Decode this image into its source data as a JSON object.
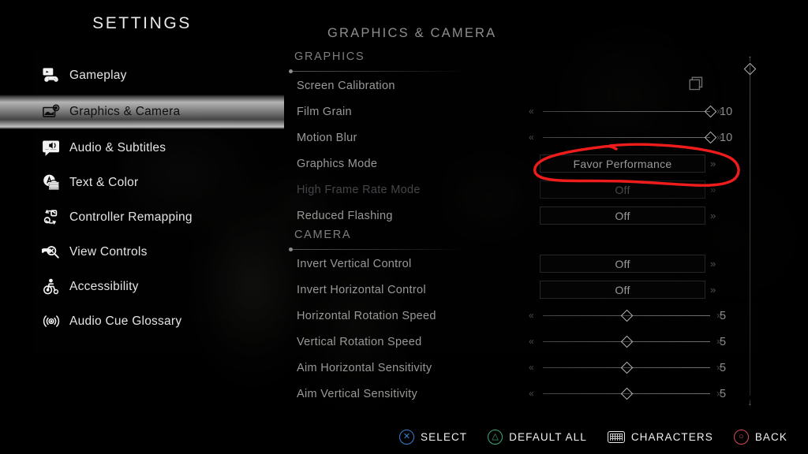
{
  "app": {
    "title": "SETTINGS"
  },
  "sidebar": {
    "items": [
      {
        "label": "Gameplay",
        "icon": "gameplay-icon",
        "selected": false
      },
      {
        "label": "Graphics & Camera",
        "icon": "graphics-camera-icon",
        "selected": true
      },
      {
        "label": "Audio & Subtitles",
        "icon": "audio-subtitles-icon",
        "selected": false
      },
      {
        "label": "Text & Color",
        "icon": "text-color-icon",
        "selected": false
      },
      {
        "label": "Controller Remapping",
        "icon": "controller-remapping-icon",
        "selected": false
      },
      {
        "label": "View Controls",
        "icon": "view-controls-icon",
        "selected": false
      },
      {
        "label": "Accessibility",
        "icon": "accessibility-icon",
        "selected": false
      },
      {
        "label": "Audio Cue Glossary",
        "icon": "audio-cue-glossary-icon",
        "selected": false
      }
    ]
  },
  "main": {
    "page_title": "GRAPHICS & CAMERA",
    "sections": [
      {
        "heading": "GRAPHICS",
        "rows": [
          {
            "label": "Screen Calibration",
            "type": "submenu",
            "icon": "stacked-squares-icon"
          },
          {
            "label": "Film Grain",
            "type": "slider",
            "value": "10",
            "percent": 100
          },
          {
            "label": "Motion Blur",
            "type": "slider",
            "value": "10",
            "percent": 100
          },
          {
            "label": "Graphics Mode",
            "type": "select",
            "value": "Favor Performance",
            "highlighted": true
          },
          {
            "label": "High Frame Rate Mode",
            "type": "select",
            "value": "Off",
            "disabled": true
          },
          {
            "label": "Reduced Flashing",
            "type": "select",
            "value": "Off"
          }
        ]
      },
      {
        "heading": "CAMERA",
        "rows": [
          {
            "label": "Invert Vertical Control",
            "type": "select",
            "value": "Off"
          },
          {
            "label": "Invert Horizontal Control",
            "type": "select",
            "value": "Off"
          },
          {
            "label": "Horizontal Rotation Speed",
            "type": "slider",
            "value": "5",
            "percent": 50
          },
          {
            "label": "Vertical Rotation Speed",
            "type": "slider",
            "value": "5",
            "percent": 50
          },
          {
            "label": "Aim Horizontal Sensitivity",
            "type": "slider",
            "value": "5",
            "percent": 50
          },
          {
            "label": "Aim Vertical Sensitivity",
            "type": "slider",
            "value": "5",
            "percent": 50
          }
        ]
      }
    ],
    "slider_arrow_left": "«",
    "slider_arrow_right": "»",
    "select_arrow_right": "»"
  },
  "scrollbar": {
    "up_arrow": "↑",
    "down_arrow": "↓"
  },
  "footer": {
    "prompts": [
      {
        "glyph": "✕",
        "button": "cross-button",
        "style": "cross",
        "label": "SELECT"
      },
      {
        "glyph": "△",
        "button": "triangle-button",
        "style": "tri",
        "label": "DEFAULT ALL"
      },
      {
        "glyph": "",
        "button": "touchpad-button",
        "style": "touch",
        "label": "CHARACTERS"
      },
      {
        "glyph": "○",
        "button": "circle-button",
        "style": "circ",
        "label": "BACK"
      }
    ]
  },
  "annotation": {
    "color": "#ef1c1c",
    "shape": "hand-drawn-ellipse",
    "targets": "Graphics Mode value"
  }
}
